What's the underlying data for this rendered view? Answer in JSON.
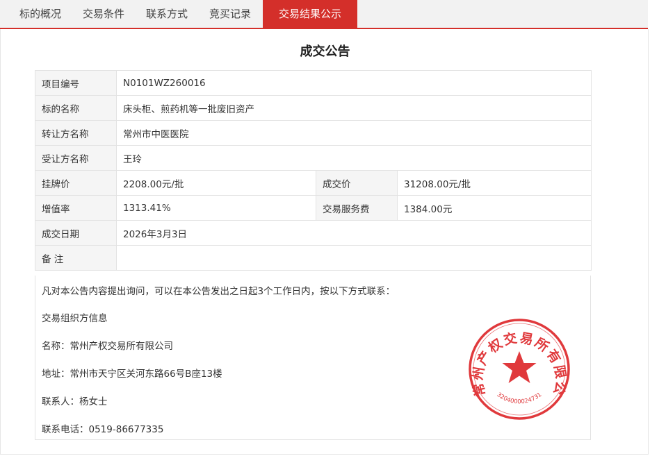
{
  "tabs": [
    {
      "label": "标的概况",
      "active": false
    },
    {
      "label": "交易条件",
      "active": false
    },
    {
      "label": "联系方式",
      "active": false
    },
    {
      "label": "竞买记录",
      "active": false
    },
    {
      "label": "交易结果公示",
      "active": true
    }
  ],
  "announcement": {
    "title": "成交公告",
    "rows": {
      "project_no": {
        "label": "项目编号",
        "value": "N0101WZ260016"
      },
      "asset_name": {
        "label": "标的名称",
        "value": "床头柜、煎药机等一批废旧资产"
      },
      "seller": {
        "label": "转让方名称",
        "value": "常州市中医医院"
      },
      "buyer": {
        "label": "受让方名称",
        "value": "王玲"
      },
      "listing_price": {
        "label": "挂牌价",
        "value": "2208.00元/批"
      },
      "deal_price": {
        "label": "成交价",
        "value": "31208.00元/批"
      },
      "appreciation": {
        "label": "增值率",
        "value": "1313.41%"
      },
      "service_fee": {
        "label": "交易服务费",
        "value": "1384.00元"
      },
      "deal_date": {
        "label": "成交日期",
        "value": "2026年3月3日"
      },
      "remark": {
        "label": "备 注",
        "value": ""
      }
    }
  },
  "contact": {
    "notice": "凡对本公告内容提出询问，可以在本公告发出之日起3个工作日内，按以下方式联系：",
    "heading": "交易组织方信息",
    "name": "名称：常州产权交易所有限公司",
    "address": "地址：常州市天宁区关河东路66号B座13楼",
    "person": "联系人：杨女士",
    "phone": "联系电话：0519-86677335"
  },
  "seal": {
    "color": "#e0393c",
    "text": "常州产权交易所有限公司",
    "code": "3204000024731",
    "icon": "star-icon"
  },
  "colors": {
    "accent": "#d42f2a",
    "label_bg": "#f5f5f5",
    "tab_bg": "#f2f2f2"
  }
}
